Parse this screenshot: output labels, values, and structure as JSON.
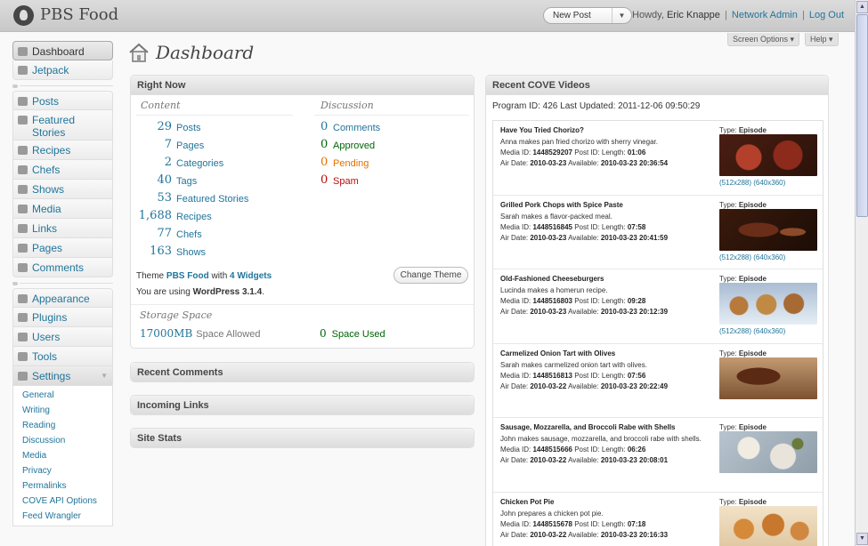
{
  "header": {
    "site_title": "PBS Food",
    "new_post": "New Post",
    "howdy": "Howdy,",
    "user": "Eric Knappe",
    "network_admin": "Network Admin",
    "logout": "Log Out"
  },
  "tabs": {
    "screen_options": "Screen Options",
    "help": "Help"
  },
  "sidebar": {
    "dashboard": "Dashboard",
    "jetpack": "Jetpack",
    "posts": "Posts",
    "featured_stories": "Featured Stories",
    "recipes": "Recipes",
    "chefs": "Chefs",
    "shows": "Shows",
    "media": "Media",
    "links": "Links",
    "pages": "Pages",
    "comments": "Comments",
    "appearance": "Appearance",
    "plugins": "Plugins",
    "users": "Users",
    "tools": "Tools",
    "settings": "Settings",
    "settings_sub": [
      "General",
      "Writing",
      "Reading",
      "Discussion",
      "Media",
      "Privacy",
      "Permalinks",
      "COVE API Options",
      "Feed Wrangler"
    ]
  },
  "page_title": "Dashboard",
  "right_now": {
    "title": "Right Now",
    "content_heading": "Content",
    "discussion_heading": "Discussion",
    "content": [
      {
        "num": "29",
        "label": "Posts"
      },
      {
        "num": "7",
        "label": "Pages"
      },
      {
        "num": "2",
        "label": "Categories"
      },
      {
        "num": "40",
        "label": "Tags"
      },
      {
        "num": "53",
        "label": "Featured Stories"
      },
      {
        "num": "1,688",
        "label": "Recipes"
      },
      {
        "num": "77",
        "label": "Chefs"
      },
      {
        "num": "163",
        "label": "Shows"
      }
    ],
    "discussion": [
      {
        "num": "0",
        "label": "Comments",
        "color": "#21759b"
      },
      {
        "num": "0",
        "label": "Approved",
        "color": "#006505"
      },
      {
        "num": "0",
        "label": "Pending",
        "color": "#e66f00"
      },
      {
        "num": "0",
        "label": "Spam",
        "color": "#bc0b0b"
      }
    ],
    "theme_prefix": "Theme",
    "theme_name": "PBS Food",
    "theme_with": "with",
    "widgets": "4 Widgets",
    "change_theme": "Change Theme",
    "version_prefix": "You are using",
    "version": "WordPress 3.1.4",
    "version_suffix": ".",
    "storage_title": "Storage Space",
    "storage_allowed_num": "17000MB",
    "storage_allowed_label": "Space Allowed",
    "storage_used_num": "0",
    "storage_used_label": "Space Used"
  },
  "boxes": {
    "recent_comments": "Recent Comments",
    "incoming_links": "Incoming Links",
    "site_stats": "Site Stats"
  },
  "cove": {
    "title": "Recent COVE Videos",
    "meta": "Program ID: 426 Last Updated: 2011-12-06 09:50:29",
    "videos": [
      {
        "title": "Have You Tried Chorizo?",
        "desc": "Anna makes pan fried chorizo with sherry vinegar.",
        "media_id": "1448529207",
        "post_id": "",
        "length": "01:06",
        "air_date": "2010-03-23",
        "available": "2010-03-23 20:36:54",
        "type": "Episode",
        "sizes": "(512x288) (640x360)"
      },
      {
        "title": "Grilled Pork Chops with Spice Paste",
        "desc": "Sarah makes a flavor-packed meal.",
        "media_id": "1448516845",
        "post_id": "",
        "length": "07:58",
        "air_date": "2010-03-23",
        "available": "2010-03-23 20:41:59",
        "type": "Episode",
        "sizes": "(512x288) (640x360)"
      },
      {
        "title": "Old-Fashioned Cheeseburgers",
        "desc": "Lucinda makes a homerun recipe.",
        "media_id": "1448516803",
        "post_id": "",
        "length": "09:28",
        "air_date": "2010-03-23",
        "available": "2010-03-23 20:12:39",
        "type": "Episode",
        "sizes": "(512x288) (640x360)"
      },
      {
        "title": "Carmelized Onion Tart with Olives",
        "desc": "Sarah makes carmelized onion tart with olives.",
        "media_id": "1448516813",
        "post_id": "",
        "length": "07:56",
        "air_date": "2010-03-22",
        "available": "2010-03-23 20:22:49",
        "type": "Episode",
        "sizes": ""
      },
      {
        "title": "Sausage, Mozzarella, and Broccoli Rabe with Shells",
        "desc": "John makes sausage, mozzarella, and broccoli rabe with shells.",
        "media_id": "1448515666",
        "post_id": "",
        "length": "06:26",
        "air_date": "2010-03-22",
        "available": "2010-03-23 20:08:01",
        "type": "Episode",
        "sizes": ""
      },
      {
        "title": "Chicken Pot Pie",
        "desc": "John prepares a chicken pot pie.",
        "media_id": "1448515678",
        "post_id": "",
        "length": "07:18",
        "air_date": "2010-03-22",
        "available": "2010-03-23 20:16:33",
        "type": "Episode",
        "sizes": ""
      }
    ],
    "labels": {
      "media_id": "Media ID:",
      "post_id": "Post ID:",
      "length": "Length:",
      "air_date": "Air Date:",
      "available": "Available:",
      "type": "Type:"
    }
  }
}
